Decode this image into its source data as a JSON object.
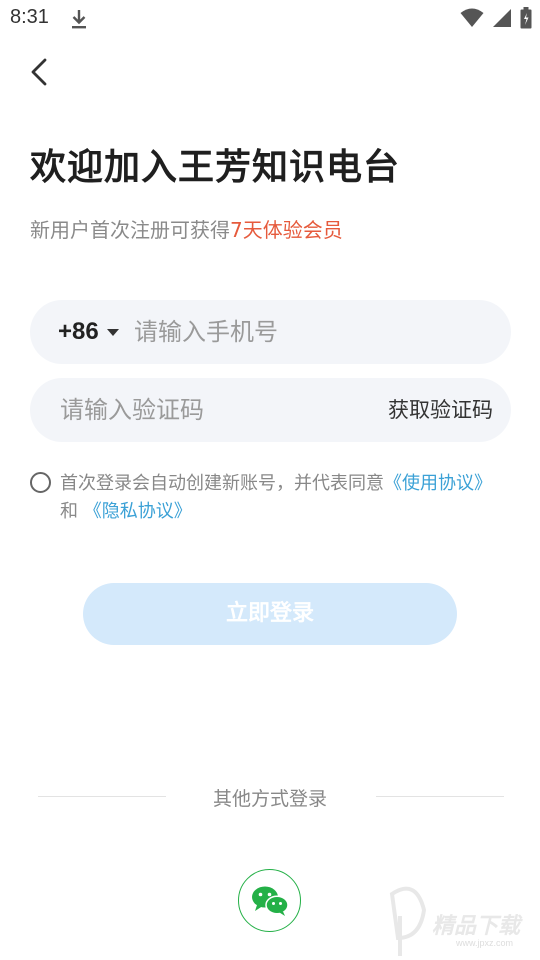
{
  "status_bar": {
    "time": "8:31",
    "icons": [
      "download-icon",
      "wifi-icon",
      "signal-icon",
      "battery-icon"
    ]
  },
  "header": {
    "back_icon": "chevron-left-icon"
  },
  "title": "欢迎加入王芳知识电台",
  "subtitle": {
    "prefix": "新用户首次注册可获得",
    "highlight": "7天体验会员",
    "highlight_color": "#e65a3c"
  },
  "phone": {
    "country_code": "+86",
    "placeholder": "请输入手机号",
    "value": ""
  },
  "code": {
    "placeholder": "请输入验证码",
    "value": "",
    "get_code_label": "获取验证码"
  },
  "agreement": {
    "checked": false,
    "text_before": "首次登录会自动创建新账号，并代表同意",
    "terms_link": "《使用协议》",
    "connector": "和",
    "privacy_link": "《隐私协议》",
    "link_color": "#3ba1d6"
  },
  "login_button": {
    "label": "立即登录",
    "background": "#d4e9fb"
  },
  "other_login": {
    "label": "其他方式登录",
    "wechat_icon": "wechat-icon",
    "wechat_color": "#24b047"
  },
  "watermark": {
    "text": "精品下载",
    "url": "www.jpxz.com"
  }
}
